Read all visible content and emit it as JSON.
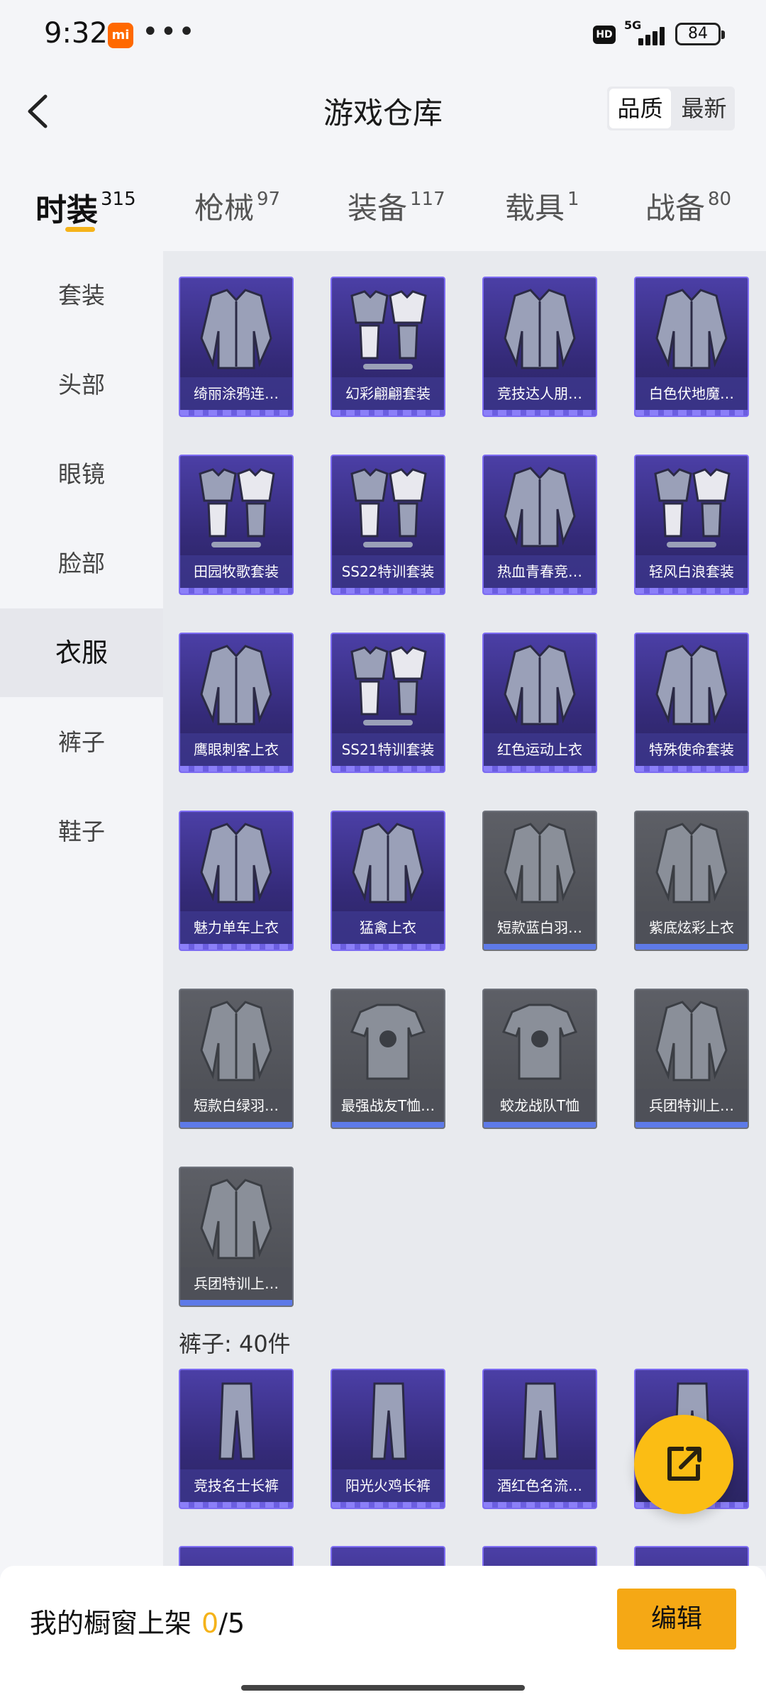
{
  "status_bar": {
    "time": "9:32",
    "network": "5G",
    "battery": "84",
    "hd": "HD",
    "mi": "mi",
    "dots": "•••"
  },
  "header": {
    "title": "游戏仓库",
    "sort_options": [
      "品质",
      "最新"
    ],
    "sort_selected": "品质"
  },
  "tabs": [
    {
      "name": "时装",
      "count": "315",
      "active": true
    },
    {
      "name": "枪械",
      "count": "97"
    },
    {
      "name": "装备",
      "count": "117"
    },
    {
      "name": "载具",
      "count": "1"
    },
    {
      "name": "战备",
      "count": "80"
    }
  ],
  "sidebar": {
    "items": [
      "套装",
      "头部",
      "眼镜",
      "脸部",
      "衣服",
      "裤子",
      "鞋子"
    ],
    "active": "衣服"
  },
  "clothes_items": [
    {
      "name": "绮丽涂鸦连…",
      "rarity": "purple",
      "icon": "hoodie-icon"
    },
    {
      "name": "幻彩翩翩套装",
      "rarity": "purple",
      "icon": "outfit-set-icon"
    },
    {
      "name": "竞技达人朋…",
      "rarity": "purple",
      "icon": "leather-coat-icon"
    },
    {
      "name": "白色伏地魔…",
      "rarity": "purple",
      "icon": "hooded-shirt-icon"
    },
    {
      "name": "田园牧歌套装",
      "rarity": "purple",
      "icon": "outfit-set-icon"
    },
    {
      "name": "SS22特训套装",
      "rarity": "purple",
      "icon": "outfit-set-icon"
    },
    {
      "name": "热血青春竞…",
      "rarity": "purple",
      "icon": "jacket-icon"
    },
    {
      "name": "轻风白浪套装",
      "rarity": "purple",
      "icon": "outfit-set-icon"
    },
    {
      "name": "鹰眼刺客上衣",
      "rarity": "purple",
      "icon": "hooded-jacket-icon"
    },
    {
      "name": "SS21特训套装",
      "rarity": "purple",
      "icon": "outfit-set-icon"
    },
    {
      "name": "红色运动上衣",
      "rarity": "purple",
      "icon": "sport-jacket-icon"
    },
    {
      "name": "特殊使命套装",
      "rarity": "purple",
      "icon": "tactical-suit-icon"
    },
    {
      "name": "魅力单车上衣",
      "rarity": "purple",
      "icon": "cycling-top-icon"
    },
    {
      "name": "猛禽上衣",
      "rarity": "purple",
      "icon": "jacket-icon"
    },
    {
      "name": "短款蓝白羽…",
      "rarity": "grey",
      "icon": "down-jacket-icon"
    },
    {
      "name": "紫底炫彩上衣",
      "rarity": "grey",
      "icon": "jacket-icon"
    },
    {
      "name": "短款白绿羽…",
      "rarity": "grey",
      "icon": "down-jacket-icon"
    },
    {
      "name": "最强战友T恤…",
      "rarity": "grey",
      "icon": "tshirt-icon"
    },
    {
      "name": "蛟龙战队T恤",
      "rarity": "grey",
      "icon": "tshirt-icon"
    },
    {
      "name": "兵团特训上…",
      "rarity": "grey",
      "icon": "jacket-icon"
    },
    {
      "name": "兵团特训上…",
      "rarity": "grey",
      "icon": "jacket-icon"
    }
  ],
  "pants_section": {
    "title": "裤子: 40件",
    "items": [
      {
        "name": "竞技名士长裤",
        "rarity": "purple",
        "icon": "pants-icon"
      },
      {
        "name": "阳光火鸡长裤",
        "rarity": "purple",
        "icon": "pants-icon"
      },
      {
        "name": "酒红色名流…",
        "rarity": "purple",
        "icon": "pants-icon"
      },
      {
        "name": "",
        "rarity": "purple",
        "icon": "pants-icon"
      }
    ]
  },
  "bottom_bar": {
    "label": "我的橱窗上架",
    "current": "0",
    "total": "/5",
    "edit": "编辑"
  },
  "colors": {
    "accent": "#f5b31a",
    "rarity_purple": "#4b3fa6",
    "rarity_grey": "#5d5f66"
  }
}
